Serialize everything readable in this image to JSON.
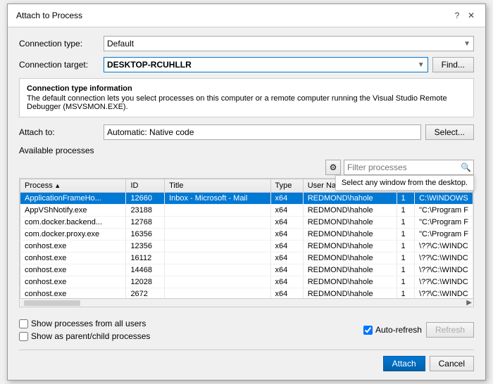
{
  "dialog": {
    "title": "Attach to Process",
    "help_btn": "?",
    "close_btn": "✕"
  },
  "connection_type": {
    "label": "Connection type:",
    "value": "Default"
  },
  "connection_target": {
    "label": "Connection target:",
    "value": "DESKTOP-RCUHLLR",
    "find_btn": "Find..."
  },
  "info_box": {
    "title": "Connection type information",
    "text": "The default connection lets you select processes on this computer or a remote computer running the Visual Studio Remote Debugger (MSVSMON.EXE)."
  },
  "attach_to": {
    "label": "Attach to:",
    "value": "Automatic: Native code",
    "select_btn": "Select..."
  },
  "processes": {
    "section_label": "Available processes",
    "filter_placeholder": "Filter processes",
    "tooltip": "Select any window from the desktop.",
    "columns": [
      "Process",
      "ID",
      "Title",
      "Type",
      "User Name",
      "S",
      ""
    ],
    "rows": [
      {
        "process": "ApplicationFrameHo...",
        "id": "12660",
        "title": "Inbox - Microsoft - Mail",
        "type": "x64",
        "user": "REDMOND\\hahole",
        "s": "1",
        "path": "C:\\WINDOWS",
        "selected": true
      },
      {
        "process": "AppVShNotify.exe",
        "id": "23188",
        "title": "",
        "type": "x64",
        "user": "REDMOND\\hahole",
        "s": "1",
        "path": "\"C:\\Program F",
        "selected": false
      },
      {
        "process": "com.docker.backend...",
        "id": "12768",
        "title": "",
        "type": "x64",
        "user": "REDMOND\\hahole",
        "s": "1",
        "path": "\"C:\\Program F",
        "selected": false
      },
      {
        "process": "com.docker.proxy.exe",
        "id": "16356",
        "title": "",
        "type": "x64",
        "user": "REDMOND\\hahole",
        "s": "1",
        "path": "\"C:\\Program F",
        "selected": false
      },
      {
        "process": "conhost.exe",
        "id": "12356",
        "title": "",
        "type": "x64",
        "user": "REDMOND\\hahole",
        "s": "1",
        "path": "\\??\\C:\\WINDC",
        "selected": false
      },
      {
        "process": "conhost.exe",
        "id": "16112",
        "title": "",
        "type": "x64",
        "user": "REDMOND\\hahole",
        "s": "1",
        "path": "\\??\\C:\\WINDC",
        "selected": false
      },
      {
        "process": "conhost.exe",
        "id": "14468",
        "title": "",
        "type": "x64",
        "user": "REDMOND\\hahole",
        "s": "1",
        "path": "\\??\\C:\\WINDC",
        "selected": false
      },
      {
        "process": "conhost.exe",
        "id": "12028",
        "title": "",
        "type": "x64",
        "user": "REDMOND\\hahole",
        "s": "1",
        "path": "\\??\\C:\\WINDC",
        "selected": false
      },
      {
        "process": "conhost.exe",
        "id": "2672",
        "title": "",
        "type": "x64",
        "user": "REDMOND\\hahole",
        "s": "1",
        "path": "\\??\\C:\\WINDC",
        "selected": false
      }
    ]
  },
  "checkboxes": {
    "show_all_users": {
      "label": "Show processes from all users",
      "checked": false
    },
    "show_parent_child": {
      "label": "Show as parent/child processes",
      "checked": false
    }
  },
  "auto_refresh": {
    "label": "Auto-refresh",
    "checked": true
  },
  "buttons": {
    "refresh": "Refresh",
    "attach": "Attach",
    "cancel": "Cancel"
  }
}
